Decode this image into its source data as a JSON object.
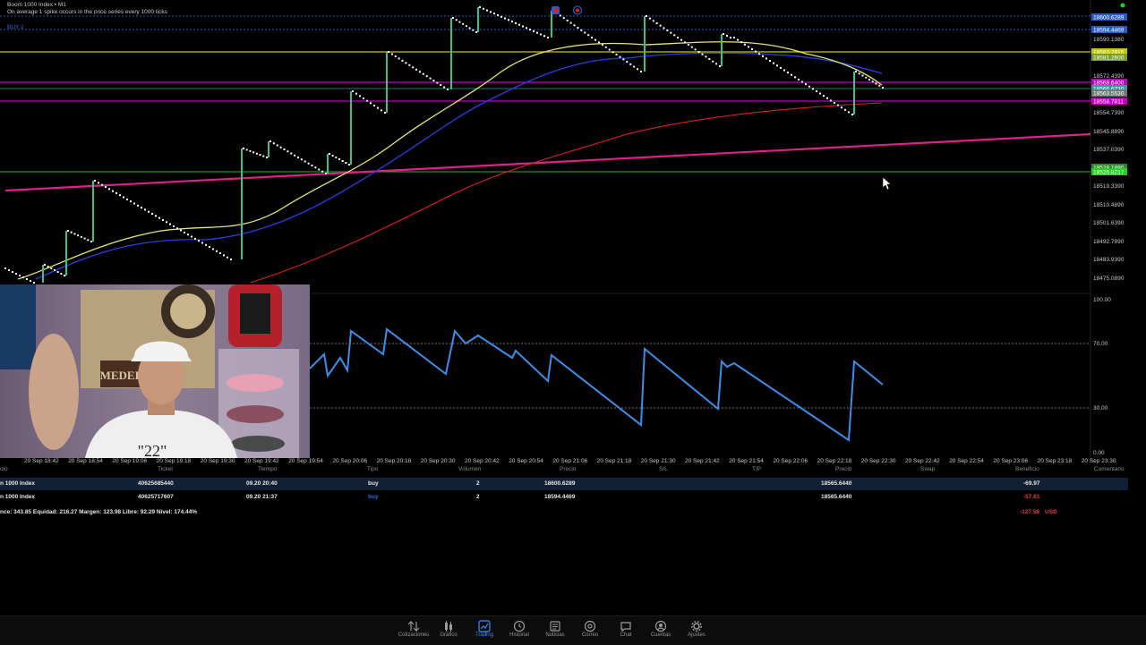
{
  "chart": {
    "symbol_title": "Boom 1000 Index • M1",
    "description": "On average 1 spike occurs in the price series every 1000 ticks",
    "order_line_label": "BUY 2",
    "price_ticks": [
      "18590.1380",
      "18572.4390",
      "18554.7390",
      "18545.8890",
      "18537.0390",
      "18519.3390",
      "18510.4890",
      "18501.6390",
      "18492.7890",
      "18483.9390",
      "18475.0890"
    ],
    "price_tags": [
      {
        "label": "18600.6289",
        "color": "#2a5cc9"
      },
      {
        "label": "18594.4469",
        "color": "#2a5cc9"
      },
      {
        "label": "18583.7815",
        "color": "#c8c800"
      },
      {
        "label": "18581.2600",
        "color": "#7aa02a"
      },
      {
        "label": "18568.6400",
        "color": "#c000c0"
      },
      {
        "label": "18566.6730",
        "color": "#2aa0a0"
      },
      {
        "label": "18563.5530",
        "color": "#777777"
      },
      {
        "label": "18558.7811",
        "color": "#c000c0"
      },
      {
        "label": "18528.1890",
        "color": "#2a8a2a"
      },
      {
        "label": "18526.8217",
        "color": "#1fd21f"
      }
    ],
    "oscillator_ticks": [
      "100.00",
      "70.00",
      "30.00",
      "0.00"
    ],
    "time_ticks": [
      "20 Sep 18:42",
      "20 Sep 18:54",
      "20 Sep 19:06",
      "20 Sep 19:18",
      "20 Sep 19:30",
      "20 Sep 19:42",
      "20 Sep 19:54",
      "20 Sep 20:06",
      "20 Sep 20:18",
      "20 Sep 20:30",
      "20 Sep 20:42",
      "20 Sep 20:54",
      "20 Sep 21:06",
      "20 Sep 21:18",
      "20 Sep 21:30",
      "20 Sep 21:42",
      "20 Sep 21:54",
      "20 Sep 22:06",
      "20 Sep 22:18",
      "20 Sep 22:30",
      "20 Sep 22:42",
      "20 Sep 22:54",
      "20 Sep 23:06",
      "20 Sep 23:18",
      "20 Sep 23:30"
    ],
    "colors": {
      "yellow": "#e8e86a",
      "blue": "#2a3fe0",
      "red": "#e02020",
      "magenta": "#e0208a",
      "oscillator": "#3d8ee8",
      "candle": "#3fbf8a"
    }
  },
  "trades": {
    "headers": {
      "symbol": "olo",
      "ticket": "Ticket",
      "time": "Tiempo",
      "type": "Tipo",
      "volume": "Volumen",
      "price": "Precio",
      "sl": "S/L",
      "tp": "T/P",
      "cur_price": "Precio",
      "swap": "Swap",
      "profit": "Beneficio",
      "comment": "Comentario"
    },
    "rows": [
      {
        "symbol": "n 1000 Index",
        "ticket": "40625685440",
        "time": "09.20 20:40",
        "type": "buy",
        "volume": "2",
        "price": "18600.6289",
        "cur_price": "18565.6440",
        "profit": "-69.97"
      },
      {
        "symbol": "n 1000 Index",
        "ticket": "40625717607",
        "time": "09.20 21:37",
        "type": "buy",
        "volume": "2",
        "price": "18594.4469",
        "cur_price": "18565.6440",
        "profit": "-57.61"
      }
    ],
    "summary": "nce: 343.85 Equidad: 216.27 Margen: 123.98 Libre: 92.29 Nivel: 174.44%",
    "total_profit": "-127.58",
    "currency": "USD"
  },
  "tabs": [
    {
      "label": "Cotizaciones",
      "icon": "arrows-updown-icon"
    },
    {
      "label": "Gráfico",
      "icon": "candles-icon"
    },
    {
      "label": "Trading",
      "icon": "trend-chart-icon",
      "active": true
    },
    {
      "label": "Historial",
      "icon": "clock-history-icon"
    },
    {
      "label": "Noticias",
      "icon": "newspaper-icon"
    },
    {
      "label": "Correo",
      "icon": "at-mail-icon"
    },
    {
      "label": "Chat",
      "icon": "chat-bubble-icon"
    },
    {
      "label": "Cuentas",
      "icon": "account-icon"
    },
    {
      "label": "Ajustes",
      "icon": "gear-icon"
    }
  ],
  "webcam": {
    "sign_text": "MEDELLIN",
    "shirt_text": "\"22\""
  }
}
